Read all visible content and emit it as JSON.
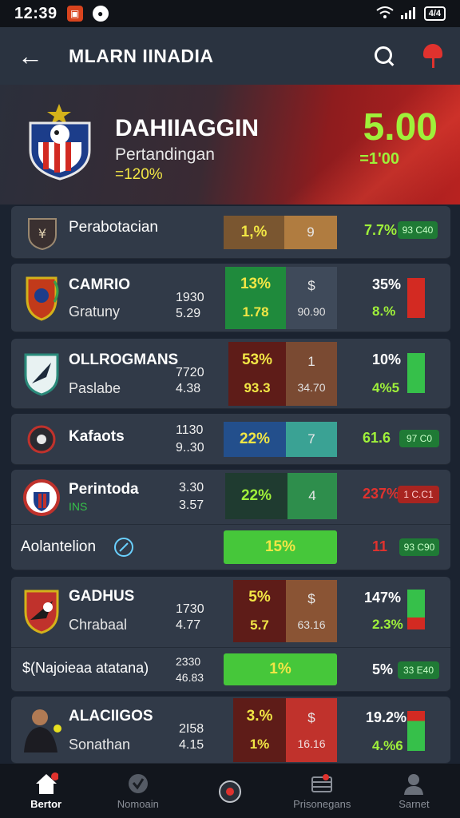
{
  "status_bar": {
    "time": "12:39",
    "battery": "4/4"
  },
  "header": {
    "title": "MLARN IINADIA"
  },
  "hero": {
    "title": "DAHIIAGGIN",
    "subtitle": "Pertandingan",
    "change": "=120%",
    "score": "5.00",
    "score_sub": "=1'00"
  },
  "matches": [
    {
      "name": "Perabotacian",
      "left_pct": "1,%",
      "right_val": "9",
      "right_top": "7.7%",
      "pill": "93 C40",
      "left_color": "#7a5630",
      "right_color": "#b07c40"
    },
    {
      "name": "CAMRIO",
      "sub": "Gratuny",
      "num_a": "1930",
      "num_b": "5.29",
      "left_pct": "13%",
      "left_val": "1.78",
      "right_val": "$",
      "right_sub": "90.90",
      "right_top": "35%",
      "right_bot": "8.%",
      "bar_color": "#d32a22",
      "left_color": "#1f8a3c",
      "right_color": "#3f4a5a"
    },
    {
      "name": "OLLROGMANS",
      "sub": "Paslabe",
      "num_a": "7720",
      "num_b": "4.38",
      "left_pct": "53%",
      "left_val": "93.3",
      "right_val": "1",
      "right_sub": "34.70",
      "right_top": "10%",
      "right_bot": "4%5",
      "bar_color": "#36c04a",
      "left_color": "#5e1c18",
      "right_color": "#7a4a32"
    },
    {
      "name": "Kafaots",
      "num_a": "1130",
      "num_b": "9..30",
      "left_pct": "22%",
      "right_val": "7",
      "right_top": "61.6",
      "pill": "97 C0",
      "left_color": "#234f8c",
      "right_color": "#3aa294"
    },
    {
      "name": "Perintoda",
      "sub": "INS",
      "num_a": "3.30",
      "num_b": "3.57",
      "left_pct": "22%",
      "right_val": "4",
      "right_top": "237%",
      "pill": "1 C.C1",
      "left_color": "#1f3b30",
      "right_color": "#2e8e4c"
    },
    {
      "name": "Aolantelion",
      "left_pct": "15%",
      "right_top": "11",
      "pill": "93 C90",
      "left_color": "#46c73a"
    },
    {
      "name": "GADHUS",
      "sub": "Chrabaal",
      "num_a": "1730",
      "num_b": "4.77",
      "left_pct": "5%",
      "left_val": "5.7",
      "right_val": "$",
      "right_sub": "63.16",
      "right_top": "147%",
      "right_bot": "2.3%",
      "bar_color": "#36c04a",
      "left_color": "#5e1c18",
      "right_color": "#8a5434"
    },
    {
      "name": "$(Najoieaa atatana)",
      "num_a": "2330",
      "num_b": "46.83",
      "left_pct": "1%",
      "right_top": "5%",
      "pill": "33 E40",
      "left_color": "#46c73a"
    },
    {
      "name": "ALACIIGOS",
      "sub": "Sonathan",
      "num_a": "2I58",
      "num_b": "4.15",
      "left_pct": "3.%",
      "left_val": "1%",
      "right_val": "$",
      "right_sub": "16.16",
      "right_top": "19.2%",
      "right_bot": "4.%6",
      "bar_color": "#36c04a",
      "left_color": "#5e1c18",
      "right_color": "#c0322c"
    }
  ],
  "nav": [
    {
      "label": "Bertor",
      "icon": "home-icon"
    },
    {
      "label": "Nomoain",
      "icon": "checkmark-icon"
    },
    {
      "label": "",
      "icon": "ball-icon"
    },
    {
      "label": "Prisonegans",
      "icon": "ticket-icon"
    },
    {
      "label": "Sarnet",
      "icon": "profile-icon"
    }
  ],
  "colors": {
    "positive": "#9ff03a",
    "negative": "#e0322e",
    "accent_yellow": "#f1e645"
  }
}
